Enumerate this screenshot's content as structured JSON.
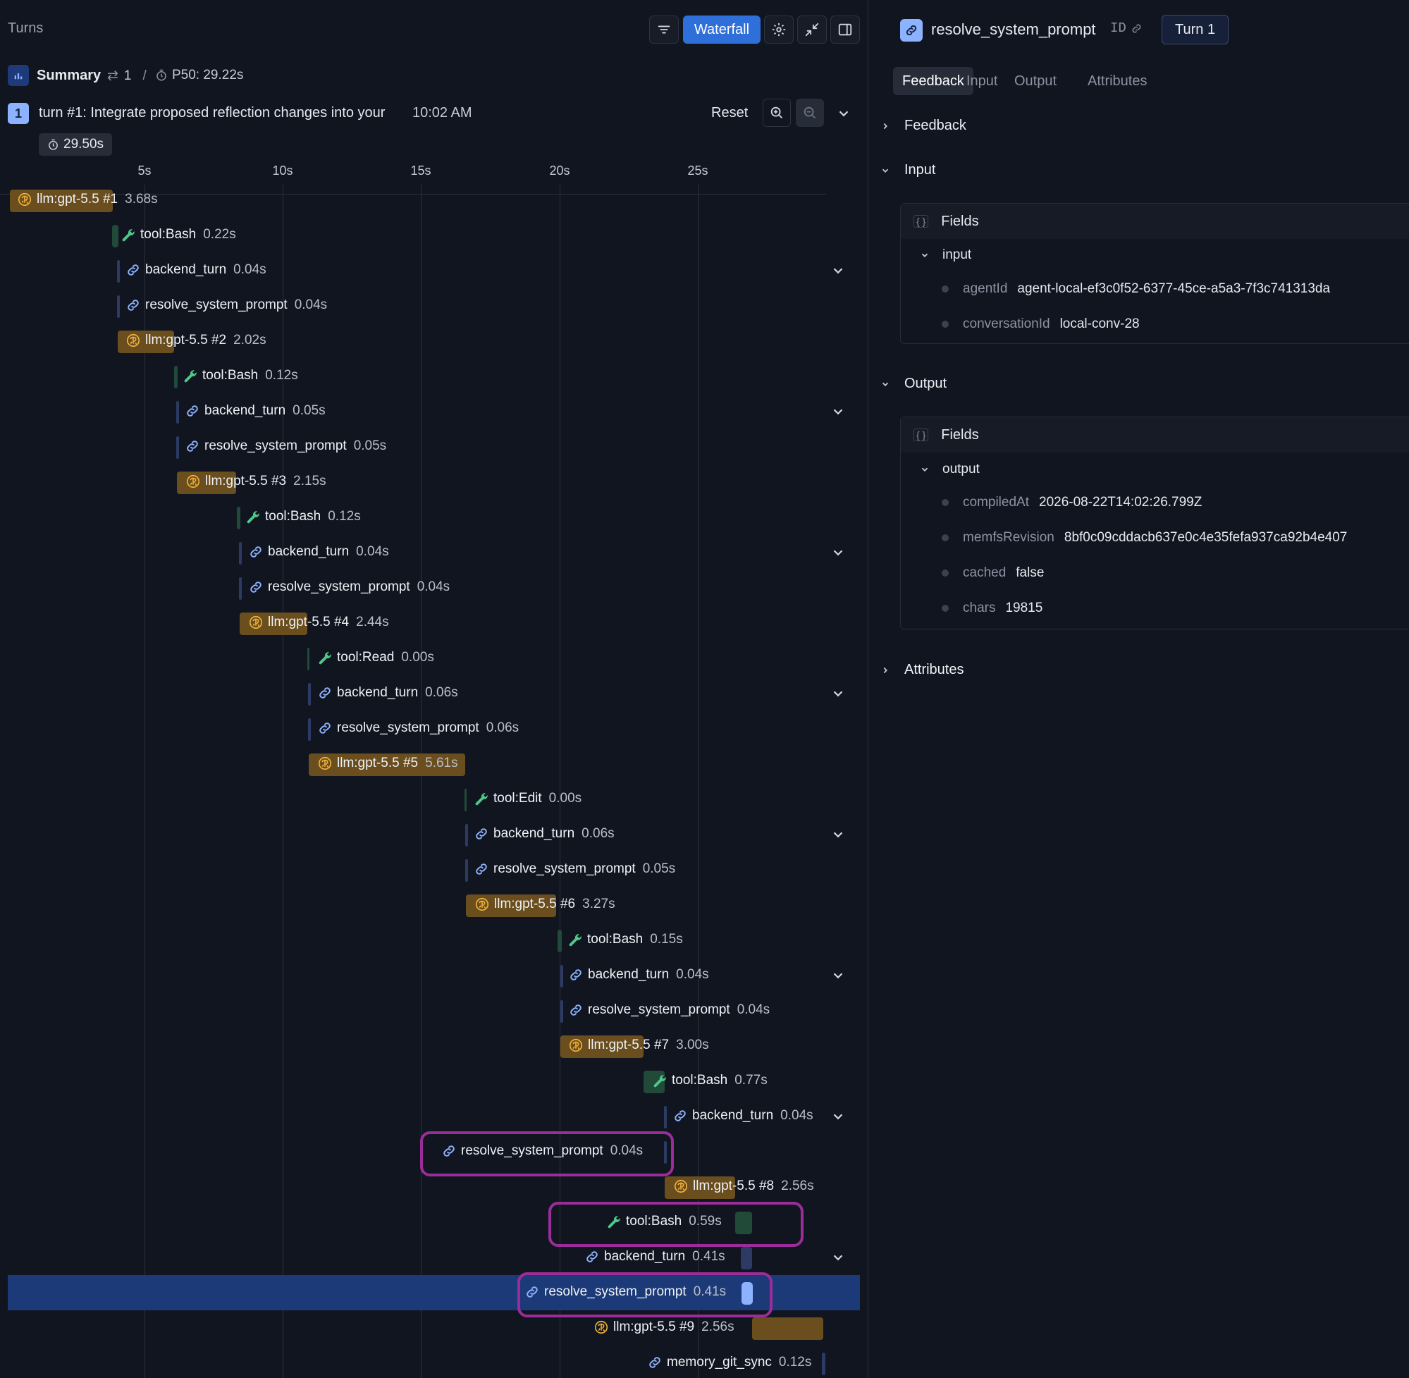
{
  "header": {
    "title": "Turns",
    "view_button": "Waterfall"
  },
  "summary": {
    "label": "Summary",
    "turn_count": "1",
    "separator": "/",
    "p50": "P50: 29.22s"
  },
  "turn": {
    "number": "1",
    "title": "turn #1: Integrate proposed reflection changes into your",
    "time": "10:02 AM",
    "reset": "Reset",
    "duration": "29.50s"
  },
  "axis": [
    "5s",
    "10s",
    "15s",
    "20s",
    "25s"
  ],
  "spans": [
    {
      "name": "llm:gpt-5.5 #1",
      "dur": "3.68s",
      "kind": "llm"
    },
    {
      "name": "tool:Bash",
      "dur": "0.22s",
      "kind": "tool"
    },
    {
      "name": "backend_turn",
      "dur": "0.04s",
      "kind": "link"
    },
    {
      "name": "resolve_system_prompt",
      "dur": "0.04s",
      "kind": "link"
    },
    {
      "name": "llm:gpt-5.5 #2",
      "dur": "2.02s",
      "kind": "llm"
    },
    {
      "name": "tool:Bash",
      "dur": "0.12s",
      "kind": "tool"
    },
    {
      "name": "backend_turn",
      "dur": "0.05s",
      "kind": "link"
    },
    {
      "name": "resolve_system_prompt",
      "dur": "0.05s",
      "kind": "link"
    },
    {
      "name": "llm:gpt-5.5 #3",
      "dur": "2.15s",
      "kind": "llm"
    },
    {
      "name": "tool:Bash",
      "dur": "0.12s",
      "kind": "tool"
    },
    {
      "name": "backend_turn",
      "dur": "0.04s",
      "kind": "link"
    },
    {
      "name": "resolve_system_prompt",
      "dur": "0.04s",
      "kind": "link"
    },
    {
      "name": "llm:gpt-5.5 #4",
      "dur": "2.44s",
      "kind": "llm"
    },
    {
      "name": "tool:Read",
      "dur": "0.00s",
      "kind": "tool"
    },
    {
      "name": "backend_turn",
      "dur": "0.06s",
      "kind": "link"
    },
    {
      "name": "resolve_system_prompt",
      "dur": "0.06s",
      "kind": "link"
    },
    {
      "name": "llm:gpt-5.5 #5",
      "dur": "5.61s",
      "kind": "llm"
    },
    {
      "name": "tool:Edit",
      "dur": "0.00s",
      "kind": "tool"
    },
    {
      "name": "backend_turn",
      "dur": "0.06s",
      "kind": "link"
    },
    {
      "name": "resolve_system_prompt",
      "dur": "0.05s",
      "kind": "link"
    },
    {
      "name": "llm:gpt-5.5 #6",
      "dur": "3.27s",
      "kind": "llm"
    },
    {
      "name": "tool:Bash",
      "dur": "0.15s",
      "kind": "tool"
    },
    {
      "name": "backend_turn",
      "dur": "0.04s",
      "kind": "link"
    },
    {
      "name": "resolve_system_prompt",
      "dur": "0.04s",
      "kind": "link"
    },
    {
      "name": "llm:gpt-5.5 #7",
      "dur": "3.00s",
      "kind": "llm"
    },
    {
      "name": "tool:Bash",
      "dur": "0.77s",
      "kind": "tool"
    },
    {
      "name": "backend_turn",
      "dur": "0.04s",
      "kind": "link"
    },
    {
      "name": "resolve_system_prompt",
      "dur": "0.04s",
      "kind": "link"
    },
    {
      "name": "llm:gpt-5.5 #8",
      "dur": "2.56s",
      "kind": "llm"
    },
    {
      "name": "tool:Bash",
      "dur": "0.59s",
      "kind": "tool"
    },
    {
      "name": "backend_turn",
      "dur": "0.41s",
      "kind": "link"
    },
    {
      "name": "resolve_system_prompt",
      "dur": "0.41s",
      "kind": "link"
    },
    {
      "name": "llm:gpt-5.5 #9",
      "dur": "2.56s",
      "kind": "llm"
    },
    {
      "name": "memory_git_sync",
      "dur": "0.12s",
      "kind": "link"
    }
  ],
  "detail": {
    "title": "resolve_system_prompt",
    "id_label": "ID",
    "turn_badge": "Turn 1",
    "tabs": [
      "Feedback",
      "Input",
      "Output",
      "Attributes"
    ],
    "sections": {
      "feedback": "Feedback",
      "input": "Input",
      "output": "Output",
      "attributes": "Attributes"
    },
    "input_card": {
      "head": "Fields",
      "group": "input",
      "fields": [
        {
          "key": "agentId",
          "value": "agent-local-ef3c0f52-6377-45ce-a5a3-7f3c741313da"
        },
        {
          "key": "conversationId",
          "value": "local-conv-28"
        }
      ]
    },
    "output_card": {
      "head": "Fields",
      "group": "output",
      "fields": [
        {
          "key": "compiledAt",
          "value": "2026-08-22T14:02:26.799Z"
        },
        {
          "key": "memfsRevision",
          "value": "8bf0c09cddacb637e0c4e35fefa937ca92b4e407"
        },
        {
          "key": "cached",
          "value": "false"
        },
        {
          "key": "chars",
          "value": "19815"
        }
      ]
    }
  },
  "colors": {
    "accent": "#2f6fd9",
    "llm_bar": "#6b4e1e",
    "tool_bar": "#214a38",
    "link_bar": "#2d3a63",
    "selected_row": "#1d3a78",
    "highlight": "#9b2d9b"
  }
}
